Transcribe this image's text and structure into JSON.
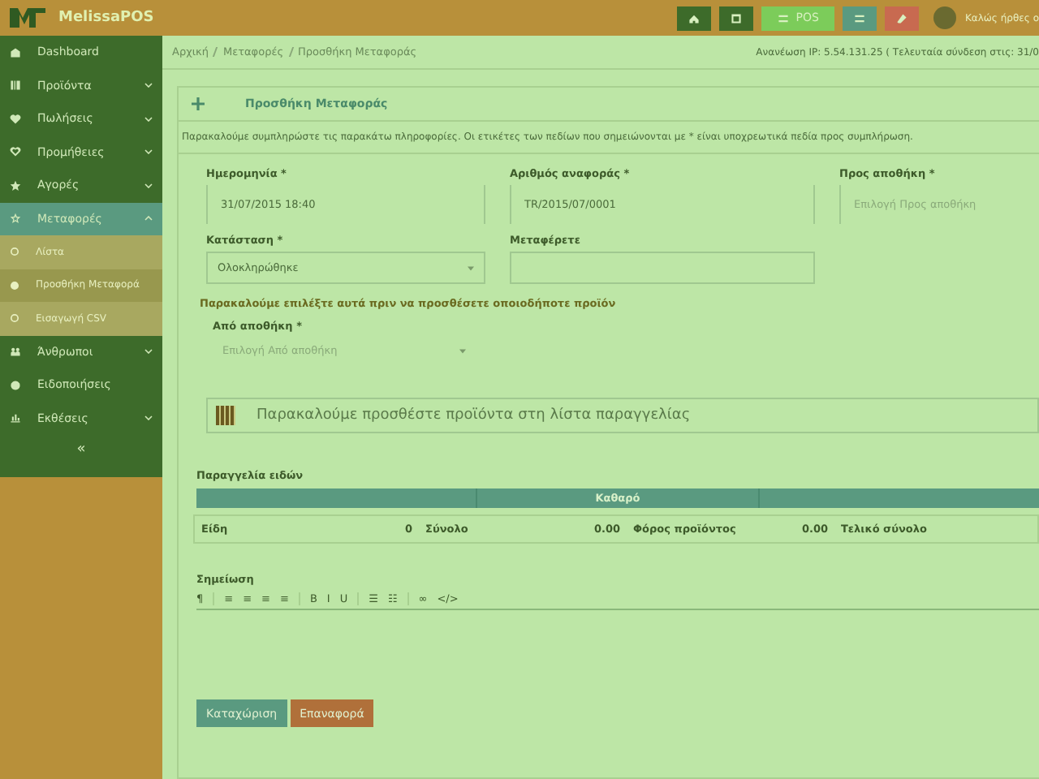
{
  "header": {
    "brand": "MelissaPOS",
    "buttons": [
      {
        "kind": "home"
      },
      {
        "kind": "window"
      },
      {
        "kind": "pos",
        "label": "POS"
      },
      {
        "kind": "list"
      },
      {
        "kind": "eraser"
      }
    ],
    "greeting": "Καλώς ήρθες ο"
  },
  "sidebar": {
    "items": [
      {
        "label": "Dashboard",
        "kind": "dashboard",
        "selected": false
      },
      {
        "label": "Προϊόντα",
        "kind": "barcode",
        "expanded": false,
        "selected": false
      },
      {
        "label": "Πωλήσεις",
        "kind": "heart",
        "expanded": false,
        "selected": false
      },
      {
        "label": "Προμήθειες",
        "kind": "heart-outline",
        "expanded": false,
        "selected": false
      },
      {
        "label": "Αγορές",
        "kind": "star",
        "expanded": false,
        "selected": false
      },
      {
        "label": "Μεταφορές",
        "kind": "star-outline",
        "expanded": true,
        "selected": true,
        "children": [
          {
            "label": "Λίστα",
            "selected": false
          },
          {
            "label": "Προσθήκη Μεταφορά",
            "selected": true
          },
          {
            "label": "Εισαγωγή CSV",
            "selected": false
          }
        ]
      },
      {
        "label": "Άνθρωποι",
        "kind": "people",
        "expanded": false,
        "selected": false
      },
      {
        "label": "Ειδοποιήσεις",
        "kind": "circle",
        "selected": false
      },
      {
        "label": "Εκθέσεις",
        "kind": "chart",
        "expanded": false,
        "selected": false
      }
    ],
    "collapse": "«"
  },
  "breadcrumb": [
    "Αρχική",
    "Μεταφορές",
    "Προσθήκη Μεταφοράς"
  ],
  "login_info": "Ανανέωση IP: 5.54.131.25 ( Τελευταία σύνδεση στις: 31/0",
  "panel": {
    "title": "Προσθήκη Μεταφοράς",
    "intro": "Παρακαλούμε συμπληρώστε τις παρακάτω πληροφορίες. Οι ετικέτες των πεδίων που σημειώνονται με * είναι υποχρεωτικά πεδία προς συμπλήρωση.",
    "fields_row1": [
      {
        "label": "Ημερομηνία *",
        "value": "31/07/2015 18:40"
      },
      {
        "label": "Αριθμός αναφοράς *",
        "value": "TR/2015/07/0001"
      },
      {
        "label": "Προς αποθήκη *",
        "placeholder": "Επιλογή Προς αποθήκη"
      }
    ],
    "status": {
      "label": "Κατάσταση *",
      "value": "Ολοκληρώθηκε"
    },
    "transporter": {
      "label": "Μεταφέρετε"
    },
    "notice": "Παρακαλούμε επιλέξτε αυτά πριν να προσθέσετε οποιοδήποτε προϊόν",
    "from": {
      "label": "Από αποθήκη *",
      "placeholder": "Επιλογή Από αποθήκη"
    },
    "product_search": {
      "placeholder": "Παρακαλούμε προσθέστε προϊόντα στη λίστα παραγγελίας"
    },
    "order_title": "Παραγγελία ειδών",
    "table": {
      "columns": [
        "Καθαρό"
      ]
    },
    "totals": [
      {
        "label": "Είδη",
        "value": "0"
      },
      {
        "label": "Σύνολο",
        "value": "0.00"
      },
      {
        "label": "Φόρος προϊόντος",
        "value": "0.00"
      },
      {
        "label": "Τελικό σύνολο"
      }
    ],
    "note_label": "Σημείωση",
    "toolbar": [
      "¶",
      "≡",
      "≡",
      "≡",
      "≡",
      "B",
      "I",
      "U",
      "☰",
      "☷",
      "∞",
      "</>"
    ],
    "buttons": [
      {
        "label": "Καταχώριση",
        "kind": "primary"
      },
      {
        "label": "Επαναφορά",
        "kind": "reset"
      }
    ]
  }
}
